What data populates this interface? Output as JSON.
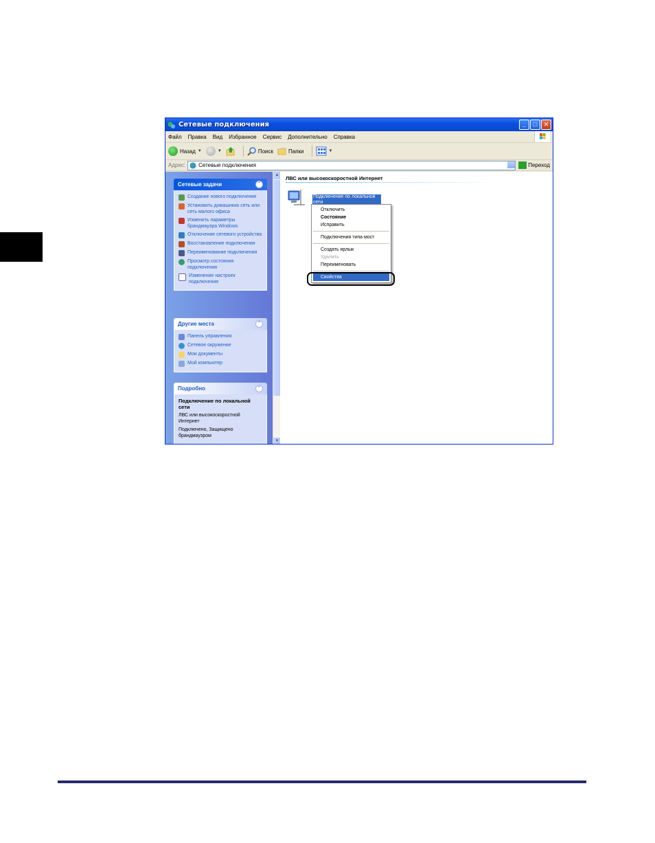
{
  "window": {
    "title": "Сетевые подключения",
    "controls": [
      "minimize",
      "maximize",
      "close"
    ]
  },
  "menubar": {
    "items": [
      "Файл",
      "Правка",
      "Вид",
      "Избранное",
      "Сервис",
      "Дополнительно",
      "Справка"
    ]
  },
  "toolbar": {
    "back_label": "Назад",
    "search_label": "Поиск",
    "folders_label": "Папки"
  },
  "address": {
    "label": "Адрес:",
    "value": "Сетевые подключения",
    "go_label": "Переход"
  },
  "sidebar": {
    "network_tasks": {
      "title": "Сетевые задачи",
      "items": [
        "Создание нового подключения",
        "Установить домашнюю сеть или сеть малого офиса",
        "Изменить параметры брандмауэра Windows",
        "Отключение сетевого устройства",
        "Восстановление подключения",
        "Переименование подключения",
        "Просмотр состояния подключения",
        "Изменение настроек подключения"
      ]
    },
    "other_places": {
      "title": "Другие места",
      "items": [
        "Панель управления",
        "Сетевое окружение",
        "Мои документы",
        "Мой компьютер"
      ]
    },
    "details": {
      "title": "Подробно",
      "name": "Подключение по локальной сети",
      "type": "ЛВС или высокоскоростной Интернет",
      "status": "Подключено, Защищено брандмауэром"
    }
  },
  "content": {
    "group_title": "ЛВС или высокоскоростной Интернет",
    "connection_label": "Подключение по локальной сети"
  },
  "context_menu": {
    "items": [
      "Отключить",
      "Состояние",
      "Исправить",
      "Подключения типа мост",
      "Создать ярлык",
      "Удалить",
      "Переименовать",
      "Свойства"
    ],
    "selected": "Свойства",
    "disabled": "Удалить",
    "default_bold": "Состояние"
  },
  "colors": {
    "title_bar": "#0a4ee0",
    "task_pane": "#6375d6",
    "selection": "#316ac5",
    "link": "#215dc6",
    "page_rule": "#2a2a6e"
  }
}
